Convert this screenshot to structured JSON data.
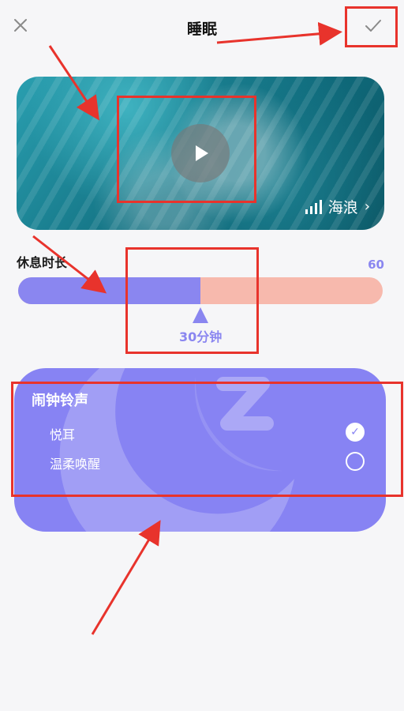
{
  "header": {
    "title": "睡眠",
    "close_icon": "close-icon",
    "confirm_icon": "check-icon"
  },
  "media": {
    "sound_name": "海浪",
    "play_icon": "play-icon",
    "sound_icon": "sound-bars-icon",
    "chevron_icon": "chevron-right-icon"
  },
  "duration": {
    "label": "休息时长",
    "max": "60",
    "value": "30分钟",
    "fraction": 0.5
  },
  "alarm": {
    "title": "闹钟铃声",
    "options": [
      {
        "label": "悦耳",
        "selected": true
      },
      {
        "label": "温柔唤醒",
        "selected": false
      }
    ]
  },
  "colors": {
    "accent": "#8a86f0",
    "track": "#f7b9ad",
    "card": "#8783f3",
    "annotation": "#e8332c"
  }
}
